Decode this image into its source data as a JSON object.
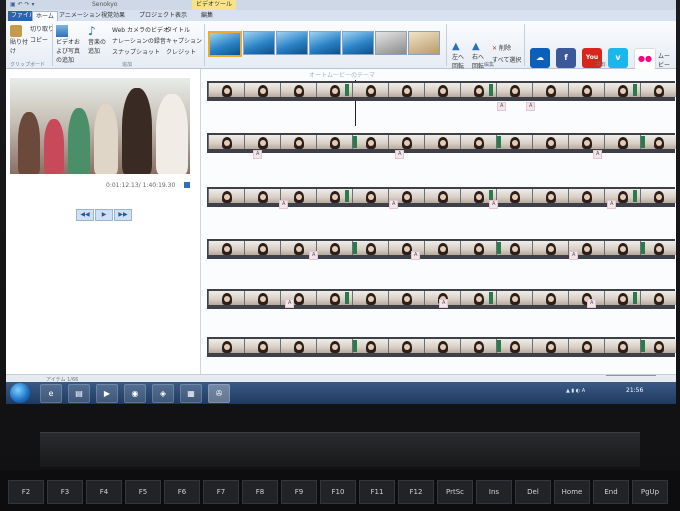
{
  "titlebar": {
    "app_title": "Senokyo",
    "context_tab": "ビデオツール"
  },
  "tabs": [
    {
      "label": "ファイル"
    },
    {
      "label": "ホーム"
    },
    {
      "label": "アニメーション"
    },
    {
      "label": "視覚効果"
    },
    {
      "label": "プロジェクト"
    },
    {
      "label": "表示"
    },
    {
      "label": "編集"
    }
  ],
  "ribbon": {
    "clipboard": {
      "paste": "貼り付け",
      "cut": "切り取り",
      "copy": "コピー",
      "group": "クリップボード"
    },
    "add": {
      "add_media": "ビデオおよび写真の追加",
      "add_music": "音楽の追加",
      "webcam": "Web カメラのビデオ",
      "narration": "ナレーションの録音",
      "snapshot": "スナップショット",
      "title": "タイトル",
      "caption": "キャプション",
      "credits": "クレジット",
      "group": "追加"
    },
    "themes_group": "オートムービーのテーマ",
    "edit": {
      "rotate_left": "左へ回転",
      "rotate_right": "右へ回転",
      "remove": "削除",
      "select_all": "すべて選択",
      "group": "編集"
    },
    "share_group": "共有",
    "save_movie": "ムービーの保存",
    "share_services": [
      {
        "name": "onedrive-icon",
        "glyph": "☁",
        "color": "#0c5fb8"
      },
      {
        "name": "facebook-icon",
        "glyph": "f",
        "color": "#3b5998"
      },
      {
        "name": "youtube-icon",
        "glyph": "You",
        "color": "#d8261d"
      },
      {
        "name": "vimeo-icon",
        "glyph": "v",
        "color": "#1ab7ea"
      },
      {
        "name": "flickr-icon",
        "glyph": "●●",
        "color": "#ffffff"
      }
    ]
  },
  "preview": {
    "timecode": "0:01:12.13/ 1:40:19.30"
  },
  "storyboard": {
    "title": "オートムービーのテーマ",
    "caption_marker": "A"
  },
  "statusbar": {
    "left": "アイテム 1/66"
  },
  "taskbar": {
    "clock": "21:56"
  },
  "keyboard": {
    "keys": [
      "F2",
      "F3",
      "F4",
      "F5",
      "F6",
      "F7",
      "F8",
      "F9",
      "F10",
      "F11",
      "F12",
      "PrtSc",
      "Ins",
      "Del",
      "Home",
      "End",
      "PgUp"
    ]
  }
}
